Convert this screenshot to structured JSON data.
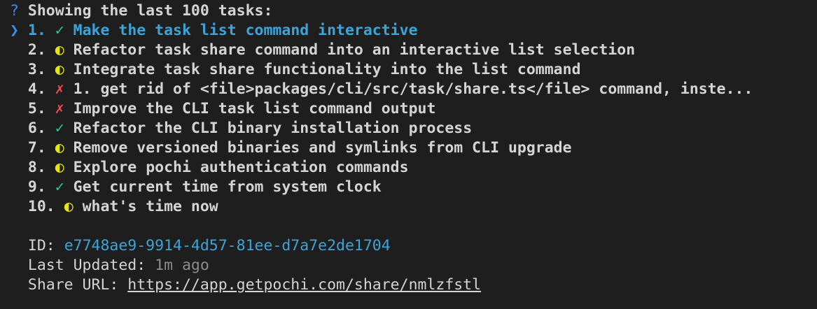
{
  "header": {
    "prompt_mark": "?",
    "text": "Showing the last 100 tasks:"
  },
  "pointer": "❯",
  "tasks": [
    {
      "num": "1.",
      "icon": "✓",
      "status": "done",
      "title": "Make the task list command interactive"
    },
    {
      "num": "2.",
      "icon": "◐",
      "status": "pending",
      "title": "Refactor task share command into an interactive list selection"
    },
    {
      "num": "3.",
      "icon": "◐",
      "status": "pending",
      "title": "Integrate task share functionality into the list command"
    },
    {
      "num": "4.",
      "icon": "✗",
      "status": "failed",
      "title": "1. get rid of <file>packages/cli/src/task/share.ts</file> command, inste..."
    },
    {
      "num": "5.",
      "icon": "✗",
      "status": "failed",
      "title": "Improve the CLI task list command output"
    },
    {
      "num": "6.",
      "icon": "✓",
      "status": "done",
      "title": "Refactor the CLI binary installation process"
    },
    {
      "num": "7.",
      "icon": "◐",
      "status": "pending",
      "title": "Remove versioned binaries and symlinks from CLI upgrade"
    },
    {
      "num": "8.",
      "icon": "◐",
      "status": "pending",
      "title": "Explore pochi authentication commands"
    },
    {
      "num": "9.",
      "icon": "✓",
      "status": "done",
      "title": "Get current time from system clock"
    },
    {
      "num": "10.",
      "icon": "◐",
      "status": "pending",
      "title": "what's time now"
    }
  ],
  "details": {
    "id_label": "ID:",
    "id_value": "e7748ae9-9914-4d57-81ee-d7a7e2de1704",
    "updated_label": "Last Updated:",
    "updated_value": "1m ago",
    "url_label": "Share URL:",
    "url_value": "https://app.getpochi.com/share/nmlzfstl"
  },
  "colors": {
    "background": "#1e1e1e",
    "selected": "#3ba4d8",
    "done": "#23d18b",
    "pending": "#e5e510",
    "failed": "#f14c4c"
  }
}
